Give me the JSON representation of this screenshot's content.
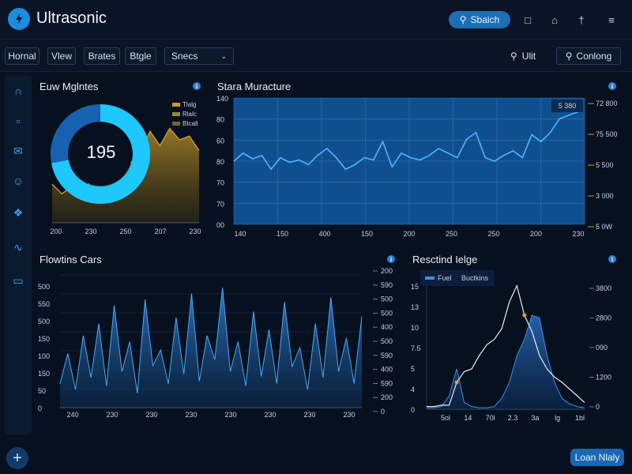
{
  "app": {
    "title": "Ultrasonic"
  },
  "header": {
    "search_label": "Sbaich",
    "icons": [
      "doc-icon",
      "home-icon",
      "pin-icon",
      "menu-icon"
    ]
  },
  "toolbar": {
    "segments": [
      "Hornal",
      "Vlew",
      "Brates",
      "Btgle"
    ],
    "select_value": "Snecs",
    "search_label": "Ulit",
    "dropdown_value": "Conlong"
  },
  "sidebar": {
    "icons": [
      "headphones-icon",
      "document-icon",
      "mail-icon",
      "person-icon",
      "puzzle-icon",
      "wave-icon",
      "monitor-icon"
    ]
  },
  "panels": {
    "p1": {
      "title": "Euw Mglntes"
    },
    "p2": {
      "title": "Stara Muracture"
    },
    "p3": {
      "title": "Flowtins Cars"
    },
    "p4": {
      "title": "Resctind Ielge"
    }
  },
  "footer": {
    "add_label": "+",
    "action_label": "Loan Nlaly"
  },
  "colors": {
    "accent": "#1a8dde",
    "gold": "#c89a26",
    "cyan": "#1ec8ff",
    "line": "#2f9df5"
  },
  "chart_data": [
    {
      "type": "area",
      "title": "Euw Mglntes",
      "donut_value": "195",
      "legend": [
        "Tlalg",
        "Rlalc",
        "Btcall"
      ],
      "x_ticks": [
        "200",
        "230",
        "250",
        "207",
        "230"
      ],
      "series": [
        {
          "name": "Tlalg",
          "values": [
            40,
            30,
            38,
            28,
            45,
            52,
            70,
            58,
            62,
            74,
            95,
            80,
            98,
            86,
            90,
            75
          ]
        }
      ],
      "donut_fraction": 0.72
    },
    {
      "type": "line",
      "title": "Stara Muracture",
      "x_ticks": [
        "140",
        "150",
        "400",
        "150",
        "200",
        "250",
        "250",
        "200",
        "230"
      ],
      "y_left_ticks": [
        "140",
        "80",
        "60",
        "80",
        "70",
        "70",
        "00"
      ],
      "y_right_ticks": [
        "72 800",
        "75 500",
        "5 500",
        "3 000",
        "5 0W"
      ],
      "annotation": "5 380",
      "values": [
        55,
        62,
        57,
        60,
        48,
        58,
        54,
        56,
        52,
        60,
        66,
        58,
        48,
        52,
        58,
        56,
        72,
        50,
        62,
        58,
        56,
        60,
        66,
        62,
        58,
        74,
        80,
        58,
        55,
        60,
        64,
        58,
        78,
        72,
        80,
        92,
        95,
        98
      ]
    },
    {
      "type": "area",
      "title": "Flowtins Cars",
      "x_ticks": [
        "240",
        "230",
        "230",
        "230",
        "230",
        "230",
        "230",
        "230"
      ],
      "y_left_ticks": [
        "500",
        "550",
        "500",
        "150",
        "100",
        "150",
        "50",
        "0"
      ],
      "y_right_ticks": [
        "200",
        "590",
        "500",
        "500",
        "400",
        "500",
        "590",
        "400",
        "590",
        "200",
        "0"
      ],
      "values": [
        20,
        45,
        15,
        60,
        25,
        70,
        18,
        85,
        30,
        55,
        12,
        90,
        35,
        48,
        20,
        75,
        28,
        95,
        22,
        60,
        40,
        100,
        30,
        55,
        18,
        80,
        26,
        65,
        20,
        88,
        34,
        50,
        15,
        70,
        25,
        92,
        30,
        58,
        20,
        76
      ]
    },
    {
      "type": "line",
      "title": "Resctind Ielge",
      "legend": [
        "Fuel",
        "Buctkins"
      ],
      "x_ticks": [
        "5ol",
        "14",
        "70l",
        "2.3",
        "3a",
        "lg",
        "1bl"
      ],
      "y_left_ticks": [
        "15",
        "13",
        "10",
        "7.5",
        "5",
        "4",
        "0"
      ],
      "y_right_ticks": [
        "3800",
        "2800",
        "090",
        "1200",
        "0"
      ],
      "line_values": [
        2,
        2,
        3,
        3,
        20,
        28,
        30,
        40,
        48,
        52,
        60,
        80,
        92,
        70,
        58,
        40,
        30,
        24,
        20,
        15,
        10,
        5
      ],
      "area_values": [
        1,
        1,
        2,
        10,
        30,
        5,
        2,
        1,
        1,
        2,
        8,
        20,
        40,
        52,
        70,
        68,
        40,
        20,
        8,
        4,
        2,
        1
      ]
    }
  ]
}
